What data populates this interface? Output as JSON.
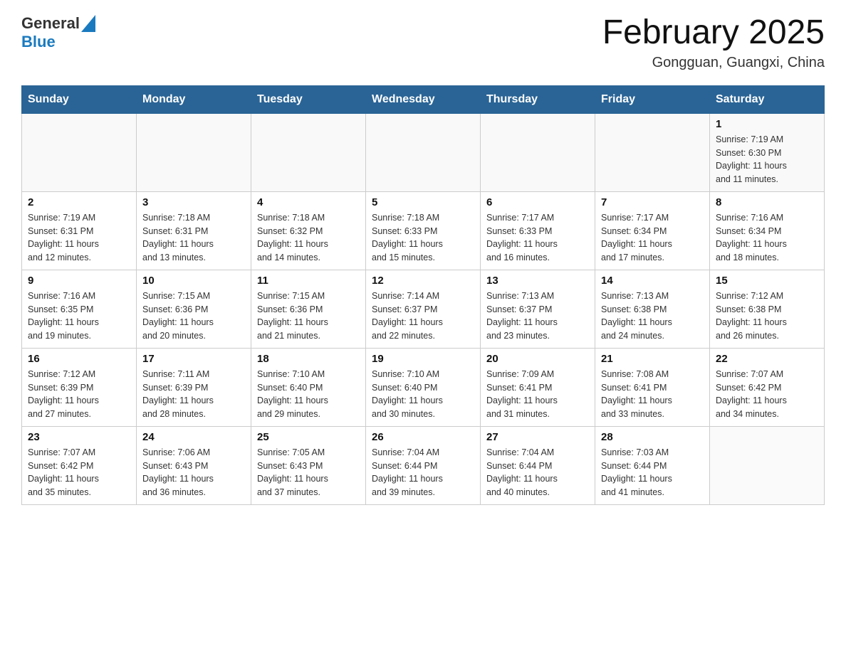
{
  "header": {
    "logo_general": "General",
    "logo_blue": "Blue",
    "month_title": "February 2025",
    "location": "Gongguan, Guangxi, China"
  },
  "days_of_week": [
    "Sunday",
    "Monday",
    "Tuesday",
    "Wednesday",
    "Thursday",
    "Friday",
    "Saturday"
  ],
  "weeks": [
    {
      "cells": [
        {
          "day": "",
          "info": ""
        },
        {
          "day": "",
          "info": ""
        },
        {
          "day": "",
          "info": ""
        },
        {
          "day": "",
          "info": ""
        },
        {
          "day": "",
          "info": ""
        },
        {
          "day": "",
          "info": ""
        },
        {
          "day": "1",
          "info": "Sunrise: 7:19 AM\nSunset: 6:30 PM\nDaylight: 11 hours\nand 11 minutes."
        }
      ]
    },
    {
      "cells": [
        {
          "day": "2",
          "info": "Sunrise: 7:19 AM\nSunset: 6:31 PM\nDaylight: 11 hours\nand 12 minutes."
        },
        {
          "day": "3",
          "info": "Sunrise: 7:18 AM\nSunset: 6:31 PM\nDaylight: 11 hours\nand 13 minutes."
        },
        {
          "day": "4",
          "info": "Sunrise: 7:18 AM\nSunset: 6:32 PM\nDaylight: 11 hours\nand 14 minutes."
        },
        {
          "day": "5",
          "info": "Sunrise: 7:18 AM\nSunset: 6:33 PM\nDaylight: 11 hours\nand 15 minutes."
        },
        {
          "day": "6",
          "info": "Sunrise: 7:17 AM\nSunset: 6:33 PM\nDaylight: 11 hours\nand 16 minutes."
        },
        {
          "day": "7",
          "info": "Sunrise: 7:17 AM\nSunset: 6:34 PM\nDaylight: 11 hours\nand 17 minutes."
        },
        {
          "day": "8",
          "info": "Sunrise: 7:16 AM\nSunset: 6:34 PM\nDaylight: 11 hours\nand 18 minutes."
        }
      ]
    },
    {
      "cells": [
        {
          "day": "9",
          "info": "Sunrise: 7:16 AM\nSunset: 6:35 PM\nDaylight: 11 hours\nand 19 minutes."
        },
        {
          "day": "10",
          "info": "Sunrise: 7:15 AM\nSunset: 6:36 PM\nDaylight: 11 hours\nand 20 minutes."
        },
        {
          "day": "11",
          "info": "Sunrise: 7:15 AM\nSunset: 6:36 PM\nDaylight: 11 hours\nand 21 minutes."
        },
        {
          "day": "12",
          "info": "Sunrise: 7:14 AM\nSunset: 6:37 PM\nDaylight: 11 hours\nand 22 minutes."
        },
        {
          "day": "13",
          "info": "Sunrise: 7:13 AM\nSunset: 6:37 PM\nDaylight: 11 hours\nand 23 minutes."
        },
        {
          "day": "14",
          "info": "Sunrise: 7:13 AM\nSunset: 6:38 PM\nDaylight: 11 hours\nand 24 minutes."
        },
        {
          "day": "15",
          "info": "Sunrise: 7:12 AM\nSunset: 6:38 PM\nDaylight: 11 hours\nand 26 minutes."
        }
      ]
    },
    {
      "cells": [
        {
          "day": "16",
          "info": "Sunrise: 7:12 AM\nSunset: 6:39 PM\nDaylight: 11 hours\nand 27 minutes."
        },
        {
          "day": "17",
          "info": "Sunrise: 7:11 AM\nSunset: 6:39 PM\nDaylight: 11 hours\nand 28 minutes."
        },
        {
          "day": "18",
          "info": "Sunrise: 7:10 AM\nSunset: 6:40 PM\nDaylight: 11 hours\nand 29 minutes."
        },
        {
          "day": "19",
          "info": "Sunrise: 7:10 AM\nSunset: 6:40 PM\nDaylight: 11 hours\nand 30 minutes."
        },
        {
          "day": "20",
          "info": "Sunrise: 7:09 AM\nSunset: 6:41 PM\nDaylight: 11 hours\nand 31 minutes."
        },
        {
          "day": "21",
          "info": "Sunrise: 7:08 AM\nSunset: 6:41 PM\nDaylight: 11 hours\nand 33 minutes."
        },
        {
          "day": "22",
          "info": "Sunrise: 7:07 AM\nSunset: 6:42 PM\nDaylight: 11 hours\nand 34 minutes."
        }
      ]
    },
    {
      "cells": [
        {
          "day": "23",
          "info": "Sunrise: 7:07 AM\nSunset: 6:42 PM\nDaylight: 11 hours\nand 35 minutes."
        },
        {
          "day": "24",
          "info": "Sunrise: 7:06 AM\nSunset: 6:43 PM\nDaylight: 11 hours\nand 36 minutes."
        },
        {
          "day": "25",
          "info": "Sunrise: 7:05 AM\nSunset: 6:43 PM\nDaylight: 11 hours\nand 37 minutes."
        },
        {
          "day": "26",
          "info": "Sunrise: 7:04 AM\nSunset: 6:44 PM\nDaylight: 11 hours\nand 39 minutes."
        },
        {
          "day": "27",
          "info": "Sunrise: 7:04 AM\nSunset: 6:44 PM\nDaylight: 11 hours\nand 40 minutes."
        },
        {
          "day": "28",
          "info": "Sunrise: 7:03 AM\nSunset: 6:44 PM\nDaylight: 11 hours\nand 41 minutes."
        },
        {
          "day": "",
          "info": ""
        }
      ]
    }
  ]
}
